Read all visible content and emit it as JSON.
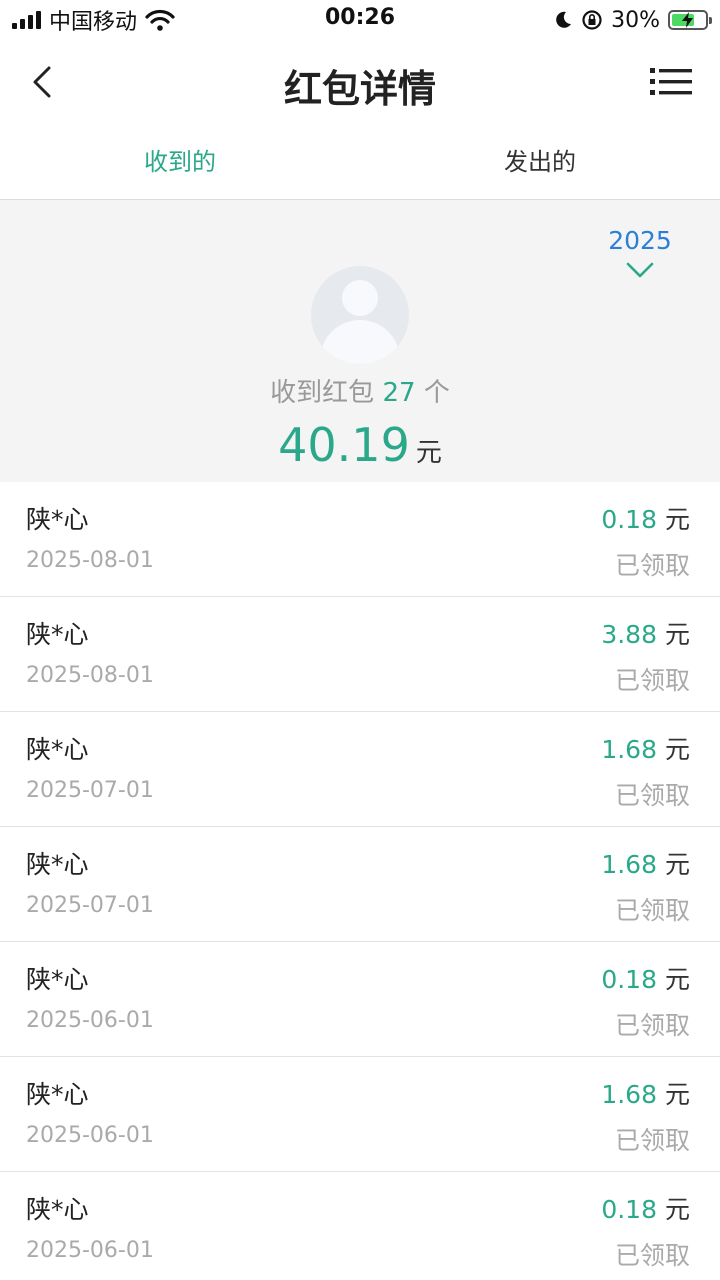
{
  "status_bar": {
    "carrier": "中国移动",
    "time": "00:26",
    "battery_percent": "30%"
  },
  "nav": {
    "title": "红包详情"
  },
  "tabs": [
    {
      "label": "收到的",
      "active": true
    },
    {
      "label": "发出的",
      "active": false
    }
  ],
  "summary": {
    "year": "2025",
    "received_prefix": "收到红包",
    "received_count": "27",
    "received_suffix": "个",
    "total_amount": "40.19",
    "total_unit": "元"
  },
  "records": [
    {
      "name": "陕*心",
      "date": "2025-08-01",
      "amount": "0.18",
      "unit": "元",
      "status": "已领取"
    },
    {
      "name": "陕*心",
      "date": "2025-08-01",
      "amount": "3.88",
      "unit": "元",
      "status": "已领取"
    },
    {
      "name": "陕*心",
      "date": "2025-07-01",
      "amount": "1.68",
      "unit": "元",
      "status": "已领取"
    },
    {
      "name": "陕*心",
      "date": "2025-07-01",
      "amount": "1.68",
      "unit": "元",
      "status": "已领取"
    },
    {
      "name": "陕*心",
      "date": "2025-06-01",
      "amount": "0.18",
      "unit": "元",
      "status": "已领取"
    },
    {
      "name": "陕*心",
      "date": "2025-06-01",
      "amount": "1.68",
      "unit": "元",
      "status": "已领取"
    },
    {
      "name": "陕*心",
      "date": "2025-06-01",
      "amount": "0.18",
      "unit": "元",
      "status": "已领取"
    }
  ],
  "colors": {
    "accent": "#2aa889",
    "year_link": "#2b7fd9",
    "summary_bg": "#f4f4f4"
  }
}
